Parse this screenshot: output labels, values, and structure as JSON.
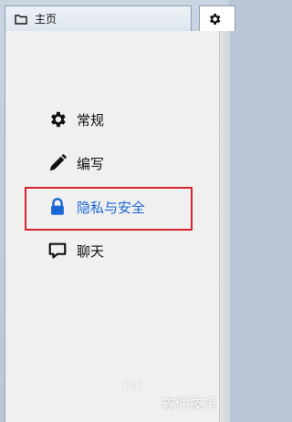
{
  "tabs": [
    {
      "label": "主页",
      "icon": "folder-icon"
    },
    {
      "label": "⚙",
      "icon": "gear-icon"
    }
  ],
  "settings_menu": {
    "items": [
      {
        "label": "常规",
        "icon": "gear-icon"
      },
      {
        "label": "编写",
        "icon": "pencil-icon"
      },
      {
        "label": "隐私与安全",
        "icon": "lock-icon",
        "highlighted": true,
        "color": "#1b66d6"
      },
      {
        "label": "聊天",
        "icon": "chat-bubble-icon"
      }
    ]
  },
  "annotation": {
    "color": "#d9232b"
  },
  "watermark": {
    "brand": "Bai",
    "sub": "软件技巧"
  }
}
